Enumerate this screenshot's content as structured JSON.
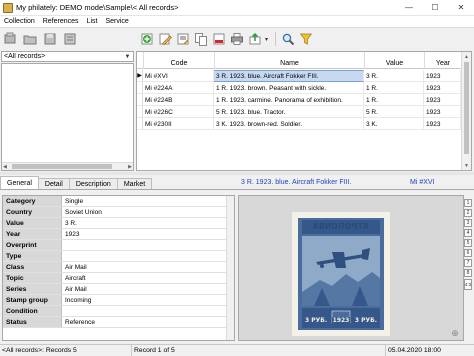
{
  "window": {
    "title": "My philately: DEMO mode\\Sample\\< All records>",
    "minimize": "—",
    "maximize": "☐",
    "close": "✕"
  },
  "menu": [
    "Collection",
    "References",
    "List",
    "Service"
  ],
  "filter": {
    "value": "<All records>"
  },
  "toolbar_left_icons": [
    "new-collection-icon",
    "open-folder-icon",
    "save-collection-icon",
    "properties-icon"
  ],
  "toolbar_right_icons": [
    "add-record-icon",
    "edit-record-icon",
    "edit-text-icon",
    "copy-record-icon",
    "delete-record-icon",
    "print-icon",
    "export-icon",
    "search-icon",
    "filter-icon"
  ],
  "grid": {
    "columns": [
      "Code",
      "Name",
      "Value",
      "Year"
    ],
    "rows": [
      {
        "code": "Mi #XVI",
        "name": "3 R. 1923. blue. Aircraft Fokker FIII.",
        "value": "3 R.",
        "year": "1923"
      },
      {
        "code": "Mi #224A",
        "name": "1 R. 1923. brown. Peasant with sickle.",
        "value": "1 R.",
        "year": "1923"
      },
      {
        "code": "Mi #224B",
        "name": "1 R. 1923. carmine. Panorama of exhibition.",
        "value": "1 R.",
        "year": "1923"
      },
      {
        "code": "Mi #226C",
        "name": "5 R. 1923. blue. Tractor.",
        "value": "5 R.",
        "year": "1923"
      },
      {
        "code": "Mi #230II",
        "name": "3 K. 1923. brown-red. Soldier.",
        "value": "3 K.",
        "year": "1923"
      }
    ],
    "selected_row_marker": "▶"
  },
  "tabs": [
    "General",
    "Detail",
    "Description",
    "Market"
  ],
  "tab_info": {
    "name": "3 R. 1923. blue. Aircraft Fokker FIII.",
    "code": "Mi #XVI"
  },
  "properties": [
    {
      "label": "Category",
      "value": "Single"
    },
    {
      "label": "Country",
      "value": "Soviet Union"
    },
    {
      "label": "Value",
      "value": "3 R."
    },
    {
      "label": "Year",
      "value": "1923"
    },
    {
      "label": "Overprint",
      "value": ""
    },
    {
      "label": "Type",
      "value": ""
    },
    {
      "label": "Class",
      "value": "Air Mail"
    },
    {
      "label": "Topic",
      "value": "Aircraft"
    },
    {
      "label": "Series",
      "value": "Air Mail"
    },
    {
      "label": "Stamp group",
      "value": "Incoming"
    },
    {
      "label": "Condition",
      "value": ""
    },
    {
      "label": "Status",
      "value": "Reference"
    }
  ],
  "image_side_buttons": [
    "1",
    "2",
    "3",
    "4",
    "5",
    "6",
    "7",
    "8",
    "4:3"
  ],
  "stamp": {
    "title": "АВИОПОЧТА",
    "left_value": "3 РУБ.",
    "year": "1923",
    "right_value": "3 РУБ."
  },
  "status": {
    "filter": "<All records>: Records 5",
    "position": "Record 1 of 5",
    "date": "05.04.2020 18:00"
  },
  "colors": {
    "selection": "#c6d9f1",
    "tab_info_text": "#1f3fbf",
    "stamp_blue": "#36578a"
  }
}
